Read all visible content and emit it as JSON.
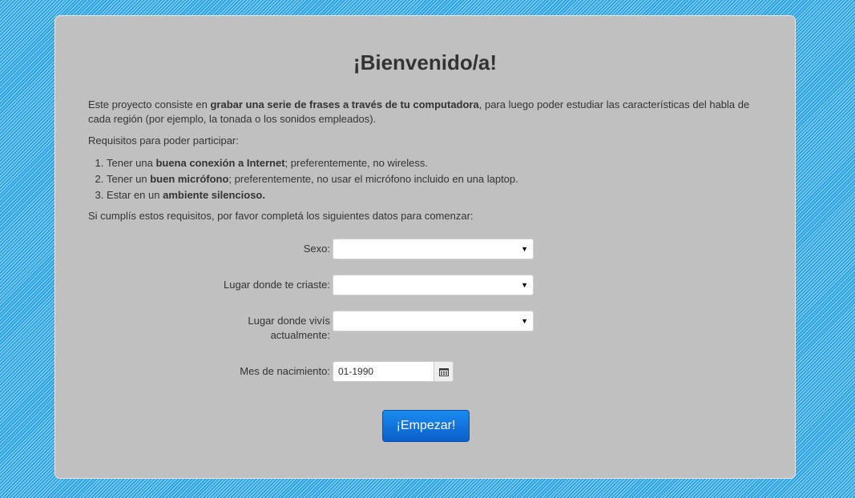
{
  "title": "¡Bienvenido/a!",
  "intro": {
    "part1": "Este proyecto consiste en ",
    "bold": "grabar una serie de frases a través de tu computadora",
    "part2": ", para luego poder estudiar las características del habla de cada región (por ejemplo, la tonada o los sonidos empleados)."
  },
  "requirements_heading": "Requisitos para poder participar:",
  "requirements": [
    {
      "pre": "Tener una ",
      "bold": "buena conexión a Internet",
      "post": "; preferentemente, no wireless."
    },
    {
      "pre": "Tener un ",
      "bold": "buen micrófono",
      "post": "; preferentemente, no usar el micrófono incluido en una laptop."
    },
    {
      "pre": "Estar en un ",
      "bold": "ambiente silencioso.",
      "post": ""
    }
  ],
  "cta_text": "Si cumplís estos requisitos, por favor completá los siguientes datos para comenzar:",
  "form": {
    "sexo_label": "Sexo:",
    "sexo_value": "",
    "lugar_criaste_label": "Lugar donde te criaste:",
    "lugar_criaste_value": "",
    "lugar_vivis_label": "Lugar donde vivís actualmente:",
    "lugar_vivis_value": "",
    "nacimiento_label": "Mes de nacimiento:",
    "nacimiento_value": "01-1990"
  },
  "start_button": "¡Empezar!",
  "icons": {
    "select_arrow": "chevron-down-icon",
    "calendar": "calendar-icon"
  },
  "colors": {
    "background": "#29a3e6",
    "card": "#c0c0c0",
    "button": "#0b6fd8"
  }
}
